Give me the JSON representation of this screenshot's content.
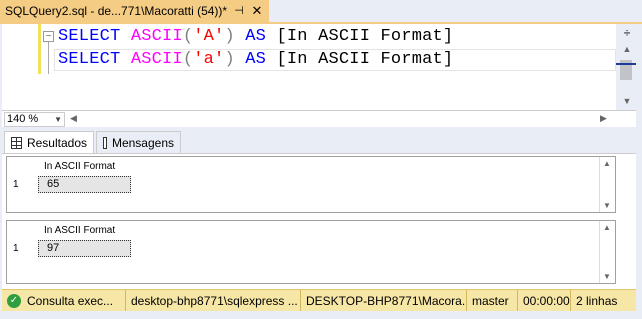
{
  "tab": {
    "title": "SQLQuery2.sql - de...771\\Macoratti (54))*",
    "pin_icon": "pin-icon",
    "close_icon": "close-icon"
  },
  "editor": {
    "lines": [
      {
        "kw1": "SELECT",
        "fn": "ASCII",
        "open": "(",
        "str": "'A'",
        "close": ")",
        "kw2": "AS",
        "alias": "[In ASCII Format]"
      },
      {
        "kw1": "SELECT",
        "fn": "ASCII",
        "open": "(",
        "str": "'a'",
        "close": ")",
        "kw2": "AS",
        "alias": "[In ASCII Format]"
      }
    ],
    "collapse_glyph": "−"
  },
  "zoom": {
    "value": "140 %"
  },
  "result_tabs": [
    {
      "label": "Resultados",
      "icon": "grid-icon",
      "active": true
    },
    {
      "label": "Mensagens",
      "icon": "message-icon",
      "active": false
    }
  ],
  "results": [
    {
      "column": "In ASCII Format",
      "row_number": "1",
      "value": "65"
    },
    {
      "column": "In ASCII Format",
      "row_number": "1",
      "value": "97"
    }
  ],
  "status": {
    "message": "Consulta  exec...",
    "server": "desktop-bhp8771\\sqlexpress ...",
    "connection": "DESKTOP-BHP8771\\Macora...",
    "database": "master",
    "elapsed": "00:00:00",
    "rows": "2 linhas",
    "ok_icon": "check-circle-icon"
  },
  "colors": {
    "tab_accent": "#f5cc84",
    "keyword": "#0000ff",
    "function": "#ff00ff",
    "string": "#ff0000",
    "status_bar": "#f7e7a6"
  }
}
